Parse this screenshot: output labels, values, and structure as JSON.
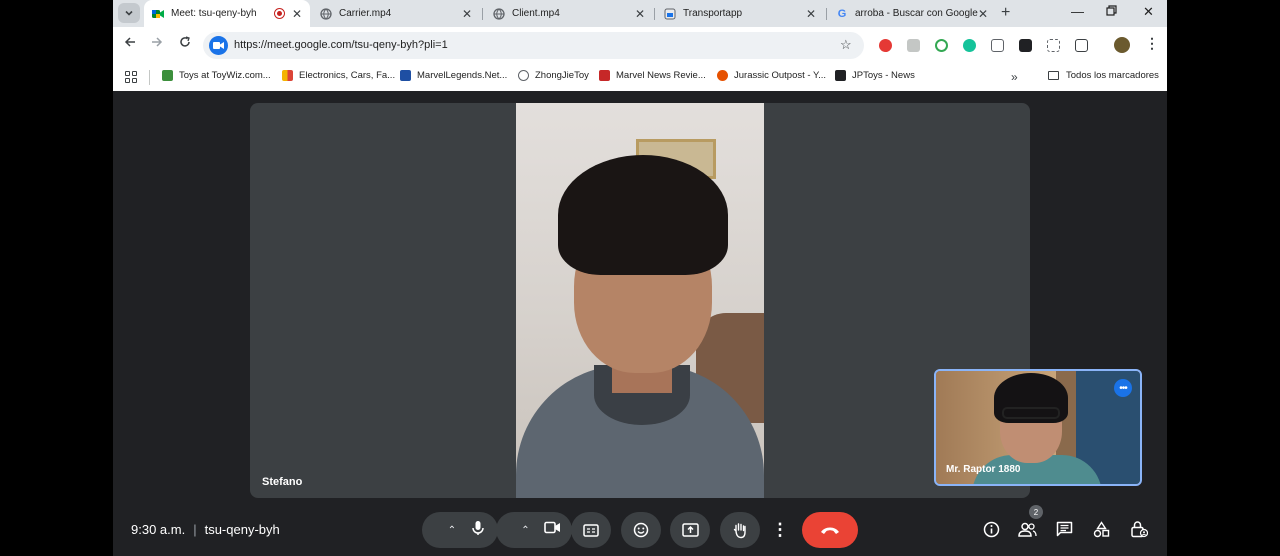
{
  "browser": {
    "tabs": [
      {
        "title": "Meet: tsu-qeny-byh",
        "active": true,
        "recording": true
      },
      {
        "title": "Carrier.mp4",
        "active": false
      },
      {
        "title": "Client.mp4",
        "active": false
      },
      {
        "title": "Transportapp",
        "active": false
      },
      {
        "title": "arroba - Buscar con Google",
        "active": false
      }
    ],
    "url": "https://meet.google.com/tsu-qeny-byh?pli=1",
    "bookmarks": [
      "Toys at ToyWiz.com...",
      "Electronics, Cars, Fa...",
      "MarvelLegends.Net...",
      "ZhongJieToy",
      "Marvel News Revie...",
      "Jurassic Outpost - Y...",
      "JPToys - News"
    ],
    "all_bookmarks_label": "Todos los marcadores"
  },
  "meet": {
    "main_participant": "Stefano",
    "self_participant": "Mr. Raptor 1880",
    "time": "9:30 a.m.",
    "meeting_code": "tsu-qeny-byh",
    "participant_count": "2"
  },
  "colors": {
    "accent": "#1a73e8",
    "hangup": "#ea4335",
    "stage": "#3c4043",
    "background": "#202124"
  }
}
